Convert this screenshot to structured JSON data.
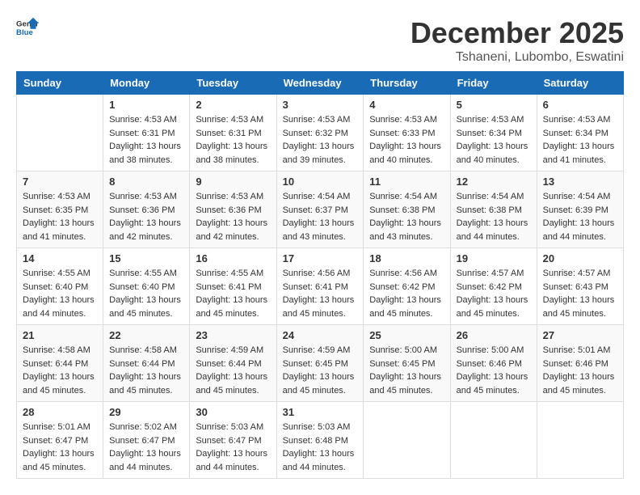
{
  "logo": {
    "general": "General",
    "blue": "Blue"
  },
  "header": {
    "month": "December 2025",
    "location": "Tshaneni, Lubombo, Eswatini"
  },
  "weekdays": [
    "Sunday",
    "Monday",
    "Tuesday",
    "Wednesday",
    "Thursday",
    "Friday",
    "Saturday"
  ],
  "weeks": [
    [
      {
        "day": "",
        "sunrise": "",
        "sunset": "",
        "daylight": ""
      },
      {
        "day": "1",
        "sunrise": "Sunrise: 4:53 AM",
        "sunset": "Sunset: 6:31 PM",
        "daylight": "Daylight: 13 hours and 38 minutes."
      },
      {
        "day": "2",
        "sunrise": "Sunrise: 4:53 AM",
        "sunset": "Sunset: 6:31 PM",
        "daylight": "Daylight: 13 hours and 38 minutes."
      },
      {
        "day": "3",
        "sunrise": "Sunrise: 4:53 AM",
        "sunset": "Sunset: 6:32 PM",
        "daylight": "Daylight: 13 hours and 39 minutes."
      },
      {
        "day": "4",
        "sunrise": "Sunrise: 4:53 AM",
        "sunset": "Sunset: 6:33 PM",
        "daylight": "Daylight: 13 hours and 40 minutes."
      },
      {
        "day": "5",
        "sunrise": "Sunrise: 4:53 AM",
        "sunset": "Sunset: 6:34 PM",
        "daylight": "Daylight: 13 hours and 40 minutes."
      },
      {
        "day": "6",
        "sunrise": "Sunrise: 4:53 AM",
        "sunset": "Sunset: 6:34 PM",
        "daylight": "Daylight: 13 hours and 41 minutes."
      }
    ],
    [
      {
        "day": "7",
        "sunrise": "Sunrise: 4:53 AM",
        "sunset": "Sunset: 6:35 PM",
        "daylight": "Daylight: 13 hours and 41 minutes."
      },
      {
        "day": "8",
        "sunrise": "Sunrise: 4:53 AM",
        "sunset": "Sunset: 6:36 PM",
        "daylight": "Daylight: 13 hours and 42 minutes."
      },
      {
        "day": "9",
        "sunrise": "Sunrise: 4:53 AM",
        "sunset": "Sunset: 6:36 PM",
        "daylight": "Daylight: 13 hours and 42 minutes."
      },
      {
        "day": "10",
        "sunrise": "Sunrise: 4:54 AM",
        "sunset": "Sunset: 6:37 PM",
        "daylight": "Daylight: 13 hours and 43 minutes."
      },
      {
        "day": "11",
        "sunrise": "Sunrise: 4:54 AM",
        "sunset": "Sunset: 6:38 PM",
        "daylight": "Daylight: 13 hours and 43 minutes."
      },
      {
        "day": "12",
        "sunrise": "Sunrise: 4:54 AM",
        "sunset": "Sunset: 6:38 PM",
        "daylight": "Daylight: 13 hours and 44 minutes."
      },
      {
        "day": "13",
        "sunrise": "Sunrise: 4:54 AM",
        "sunset": "Sunset: 6:39 PM",
        "daylight": "Daylight: 13 hours and 44 minutes."
      }
    ],
    [
      {
        "day": "14",
        "sunrise": "Sunrise: 4:55 AM",
        "sunset": "Sunset: 6:40 PM",
        "daylight": "Daylight: 13 hours and 44 minutes."
      },
      {
        "day": "15",
        "sunrise": "Sunrise: 4:55 AM",
        "sunset": "Sunset: 6:40 PM",
        "daylight": "Daylight: 13 hours and 45 minutes."
      },
      {
        "day": "16",
        "sunrise": "Sunrise: 4:55 AM",
        "sunset": "Sunset: 6:41 PM",
        "daylight": "Daylight: 13 hours and 45 minutes."
      },
      {
        "day": "17",
        "sunrise": "Sunrise: 4:56 AM",
        "sunset": "Sunset: 6:41 PM",
        "daylight": "Daylight: 13 hours and 45 minutes."
      },
      {
        "day": "18",
        "sunrise": "Sunrise: 4:56 AM",
        "sunset": "Sunset: 6:42 PM",
        "daylight": "Daylight: 13 hours and 45 minutes."
      },
      {
        "day": "19",
        "sunrise": "Sunrise: 4:57 AM",
        "sunset": "Sunset: 6:42 PM",
        "daylight": "Daylight: 13 hours and 45 minutes."
      },
      {
        "day": "20",
        "sunrise": "Sunrise: 4:57 AM",
        "sunset": "Sunset: 6:43 PM",
        "daylight": "Daylight: 13 hours and 45 minutes."
      }
    ],
    [
      {
        "day": "21",
        "sunrise": "Sunrise: 4:58 AM",
        "sunset": "Sunset: 6:44 PM",
        "daylight": "Daylight: 13 hours and 45 minutes."
      },
      {
        "day": "22",
        "sunrise": "Sunrise: 4:58 AM",
        "sunset": "Sunset: 6:44 PM",
        "daylight": "Daylight: 13 hours and 45 minutes."
      },
      {
        "day": "23",
        "sunrise": "Sunrise: 4:59 AM",
        "sunset": "Sunset: 6:44 PM",
        "daylight": "Daylight: 13 hours and 45 minutes."
      },
      {
        "day": "24",
        "sunrise": "Sunrise: 4:59 AM",
        "sunset": "Sunset: 6:45 PM",
        "daylight": "Daylight: 13 hours and 45 minutes."
      },
      {
        "day": "25",
        "sunrise": "Sunrise: 5:00 AM",
        "sunset": "Sunset: 6:45 PM",
        "daylight": "Daylight: 13 hours and 45 minutes."
      },
      {
        "day": "26",
        "sunrise": "Sunrise: 5:00 AM",
        "sunset": "Sunset: 6:46 PM",
        "daylight": "Daylight: 13 hours and 45 minutes."
      },
      {
        "day": "27",
        "sunrise": "Sunrise: 5:01 AM",
        "sunset": "Sunset: 6:46 PM",
        "daylight": "Daylight: 13 hours and 45 minutes."
      }
    ],
    [
      {
        "day": "28",
        "sunrise": "Sunrise: 5:01 AM",
        "sunset": "Sunset: 6:47 PM",
        "daylight": "Daylight: 13 hours and 45 minutes."
      },
      {
        "day": "29",
        "sunrise": "Sunrise: 5:02 AM",
        "sunset": "Sunset: 6:47 PM",
        "daylight": "Daylight: 13 hours and 44 minutes."
      },
      {
        "day": "30",
        "sunrise": "Sunrise: 5:03 AM",
        "sunset": "Sunset: 6:47 PM",
        "daylight": "Daylight: 13 hours and 44 minutes."
      },
      {
        "day": "31",
        "sunrise": "Sunrise: 5:03 AM",
        "sunset": "Sunset: 6:48 PM",
        "daylight": "Daylight: 13 hours and 44 minutes."
      },
      {
        "day": "",
        "sunrise": "",
        "sunset": "",
        "daylight": ""
      },
      {
        "day": "",
        "sunrise": "",
        "sunset": "",
        "daylight": ""
      },
      {
        "day": "",
        "sunrise": "",
        "sunset": "",
        "daylight": ""
      }
    ]
  ]
}
